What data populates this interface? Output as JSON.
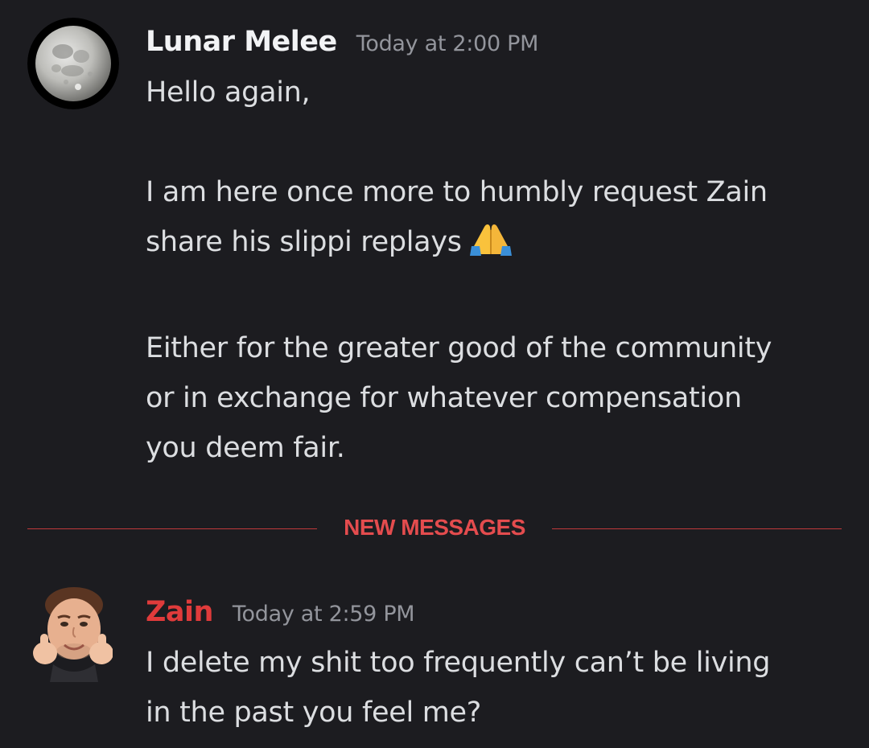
{
  "messages": [
    {
      "author": "Lunar Melee",
      "author_color": "#f2f3f5",
      "timestamp": "Today at 2:00 PM",
      "avatar": "moon-avatar-icon",
      "lines": [
        "Hello again,",
        "",
        "I am here once more to humbly request Zain",
        "share his slippi replays",
        "",
        "Either for the greater good of the community",
        "or in exchange for whatever compensation",
        "you deem fair."
      ],
      "emoji": "folded-hands-emoji"
    },
    {
      "author": "Zain",
      "author_color": "#e03b3b",
      "timestamp": "Today at 2:59 PM",
      "avatar": "thumbs-face-avatar-icon",
      "lines": [
        "I delete my shit too frequently can’t be living",
        "in the past you feel me?"
      ]
    }
  ],
  "divider": {
    "label": "NEW MESSAGES",
    "color": "#e44c4e"
  },
  "theme": {
    "background": "#1c1c20",
    "text": "#dcdee1",
    "muted": "#93959c"
  }
}
